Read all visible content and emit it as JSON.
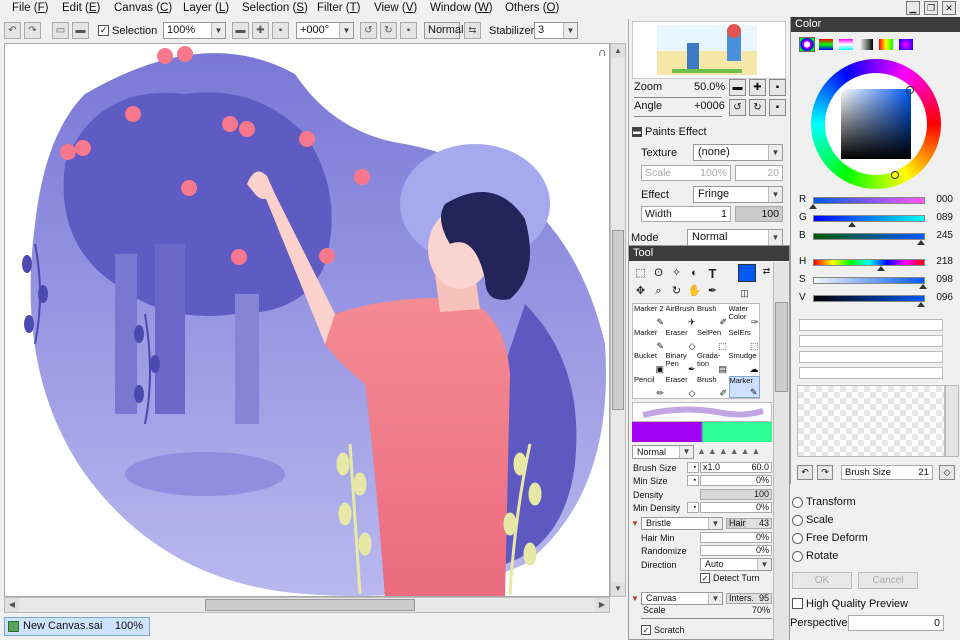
{
  "menu": [
    {
      "label": "File",
      "key": "F"
    },
    {
      "label": "Edit",
      "key": "E"
    },
    {
      "label": "Canvas",
      "key": "C"
    },
    {
      "label": "Layer",
      "key": "L"
    },
    {
      "label": "Selection",
      "key": "S"
    },
    {
      "label": "Filter",
      "key": "T"
    },
    {
      "label": "View",
      "key": "V"
    },
    {
      "label": "Window",
      "key": "W"
    },
    {
      "label": "Others",
      "key": "O"
    }
  ],
  "toolbar": {
    "selection_label": "Selection",
    "zoom": "100%",
    "rotation": "+000°",
    "blend": "Normal",
    "stabilizer_label": "Stabilizer",
    "stabilizer": "3"
  },
  "document": {
    "name": "New Canvas.sai",
    "zoom": "100%"
  },
  "navigator": {
    "zoom_label": "Zoom",
    "zoom_value": "50.0%",
    "angle_label": "Angle",
    "angle_value": "+0006"
  },
  "paints_effect": {
    "title": "Paints Effect",
    "texture_label": "Texture",
    "texture_value": "(none)",
    "scale_label": "Scale",
    "scale_value": "100%",
    "scale_num": "20",
    "effect_label": "Effect",
    "effect_value": "Fringe",
    "width_label": "Width",
    "width_value": "1",
    "width_num": "100",
    "mode_label": "Mode",
    "mode_value": "Normal"
  },
  "tool": {
    "title": "Tool",
    "brushes": [
      {
        "l1": "Marker 2",
        "l2": ""
      },
      {
        "l1": "AirBrush",
        "l2": ""
      },
      {
        "l1": "Brush",
        "l2": ""
      },
      {
        "l1": "Water",
        "l2": "Color"
      },
      {
        "l1": "Marker",
        "l2": ""
      },
      {
        "l1": "Eraser",
        "l2": ""
      },
      {
        "l1": "SelPen",
        "l2": ""
      },
      {
        "l1": "SelErs",
        "l2": ""
      },
      {
        "l1": "Bucket",
        "l2": ""
      },
      {
        "l1": "Binary",
        "l2": "Pen"
      },
      {
        "l1": "Grada-",
        "l2": "tion"
      },
      {
        "l1": "Smudge",
        "l2": ""
      },
      {
        "l1": "Pencil",
        "l2": ""
      },
      {
        "l1": "Eraser",
        "l2": ""
      },
      {
        "l1": "Brush",
        "l2": ""
      },
      {
        "l1": "Marker",
        "l2": ""
      }
    ],
    "blend": "Normal",
    "brush_size_label": "Brush Size",
    "brush_mult": "x1.0",
    "brush_size": "60.0",
    "min_size_label": "Min Size",
    "min_size": "0%",
    "density_label": "Density",
    "density": "100",
    "min_density_label": "Min Density",
    "min_density": "0%",
    "bristle": "Bristle",
    "hair_label": "Hair",
    "hair": "43",
    "hair_min_label": "Hair Min",
    "hair_min": "0%",
    "randomize_label": "Randomize",
    "randomize": "0%",
    "direction_label": "Direction",
    "direction": "Auto",
    "detect_turn": "Detect Turn",
    "texture": "Canvas",
    "inters_label": "Inters.",
    "inters": "95",
    "scale_label": "Scale",
    "scale": "70%",
    "scratch": "Scratch"
  },
  "color": {
    "title": "Color",
    "current": "#0059f5",
    "r_label": "R",
    "r": "000",
    "r_frac": 0.0,
    "g_label": "G",
    "g": "089",
    "g_frac": 0.35,
    "b_label": "B",
    "b": "245",
    "b_frac": 0.96,
    "h_label": "H",
    "h": "218",
    "h_frac": 0.61,
    "s_label": "S",
    "s": "098",
    "s_frac": 0.98,
    "v_label": "V",
    "v": "096",
    "v_frac": 0.96,
    "brush_size_label": "Brush Size",
    "brush_size": "21"
  },
  "transform": {
    "options": [
      "Transform",
      "Scale",
      "Free Deform",
      "Rotate"
    ],
    "ok": "OK",
    "cancel": "Cancel",
    "hq_preview": "High Quality Preview",
    "perspective_label": "Perspective",
    "perspective": "0"
  }
}
